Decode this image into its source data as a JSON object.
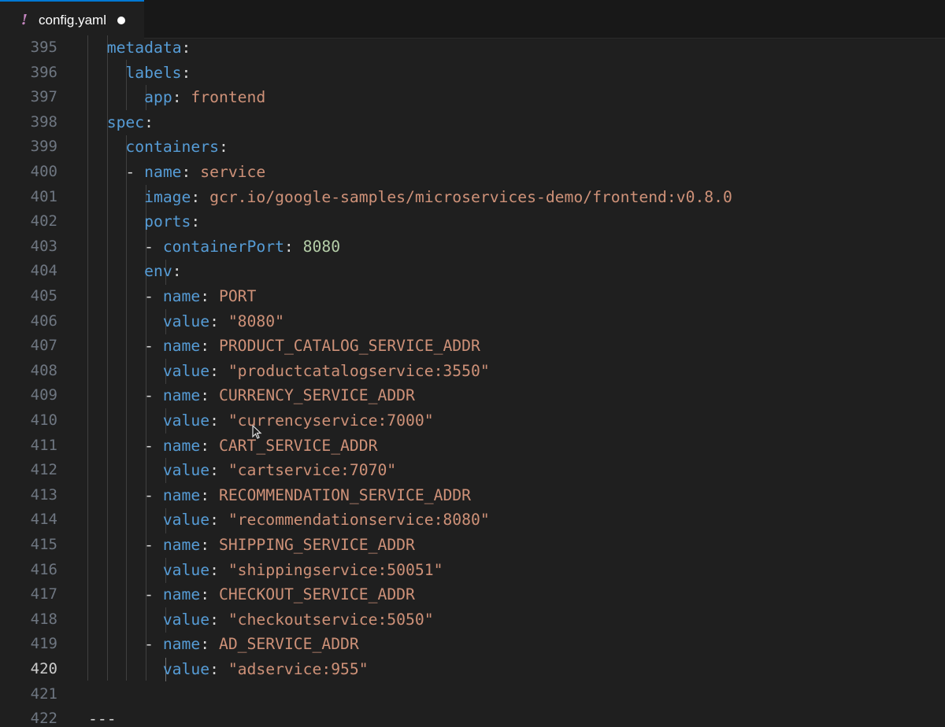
{
  "tab": {
    "icon": "!",
    "title": "config.yaml",
    "modified": true
  },
  "editor": {
    "active_line": "420",
    "lines": [
      {
        "num": "395",
        "indent": "  ",
        "key": "metadata",
        "sep": ":",
        "val": "",
        "vtype": ""
      },
      {
        "num": "396",
        "indent": "    ",
        "key": "labels",
        "sep": ":",
        "val": "",
        "vtype": ""
      },
      {
        "num": "397",
        "indent": "      ",
        "key": "app",
        "sep": ": ",
        "val": "frontend",
        "vtype": "s"
      },
      {
        "num": "398",
        "indent": "  ",
        "key": "spec",
        "sep": ":",
        "val": "",
        "vtype": ""
      },
      {
        "num": "399",
        "indent": "    ",
        "key": "containers",
        "sep": ":",
        "val": "",
        "vtype": ""
      },
      {
        "num": "400",
        "indent": "    - ",
        "key": "name",
        "sep": ": ",
        "val": "service",
        "vtype": "s"
      },
      {
        "num": "401",
        "indent": "      ",
        "key": "image",
        "sep": ": ",
        "val": "gcr.io/google-samples/microservices-demo/frontend:v0.8.0",
        "vtype": "s"
      },
      {
        "num": "402",
        "indent": "      ",
        "key": "ports",
        "sep": ":",
        "val": "",
        "vtype": ""
      },
      {
        "num": "403",
        "indent": "      - ",
        "key": "containerPort",
        "sep": ": ",
        "val": "8080",
        "vtype": "n"
      },
      {
        "num": "404",
        "indent": "      ",
        "key": "env",
        "sep": ":",
        "val": "",
        "vtype": ""
      },
      {
        "num": "405",
        "indent": "      - ",
        "key": "name",
        "sep": ": ",
        "val": "PORT",
        "vtype": "s"
      },
      {
        "num": "406",
        "indent": "        ",
        "key": "value",
        "sep": ": ",
        "val": "\"8080\"",
        "vtype": "s"
      },
      {
        "num": "407",
        "indent": "      - ",
        "key": "name",
        "sep": ": ",
        "val": "PRODUCT_CATALOG_SERVICE_ADDR",
        "vtype": "s"
      },
      {
        "num": "408",
        "indent": "        ",
        "key": "value",
        "sep": ": ",
        "val": "\"productcatalogservice:3550\"",
        "vtype": "s"
      },
      {
        "num": "409",
        "indent": "      - ",
        "key": "name",
        "sep": ": ",
        "val": "CURRENCY_SERVICE_ADDR",
        "vtype": "s"
      },
      {
        "num": "410",
        "indent": "        ",
        "key": "value",
        "sep": ": ",
        "val": "\"currencyservice:7000\"",
        "vtype": "s"
      },
      {
        "num": "411",
        "indent": "      - ",
        "key": "name",
        "sep": ": ",
        "val": "CART_SERVICE_ADDR",
        "vtype": "s"
      },
      {
        "num": "412",
        "indent": "        ",
        "key": "value",
        "sep": ": ",
        "val": "\"cartservice:7070\"",
        "vtype": "s"
      },
      {
        "num": "413",
        "indent": "      - ",
        "key": "name",
        "sep": ": ",
        "val": "RECOMMENDATION_SERVICE_ADDR",
        "vtype": "s"
      },
      {
        "num": "414",
        "indent": "        ",
        "key": "value",
        "sep": ": ",
        "val": "\"recommendationservice:8080\"",
        "vtype": "s"
      },
      {
        "num": "415",
        "indent": "      - ",
        "key": "name",
        "sep": ": ",
        "val": "SHIPPING_SERVICE_ADDR",
        "vtype": "s"
      },
      {
        "num": "416",
        "indent": "        ",
        "key": "value",
        "sep": ": ",
        "val": "\"shippingservice:50051\"",
        "vtype": "s"
      },
      {
        "num": "417",
        "indent": "      - ",
        "key": "name",
        "sep": ": ",
        "val": "CHECKOUT_SERVICE_ADDR",
        "vtype": "s"
      },
      {
        "num": "418",
        "indent": "        ",
        "key": "value",
        "sep": ": ",
        "val": "\"checkoutservice:5050\"",
        "vtype": "s"
      },
      {
        "num": "419",
        "indent": "      - ",
        "key": "name",
        "sep": ": ",
        "val": "AD_SERVICE_ADDR",
        "vtype": "s"
      },
      {
        "num": "420",
        "indent": "        ",
        "key": "value",
        "sep": ": ",
        "val": "\"adservice:955\"",
        "vtype": "s"
      },
      {
        "num": "421",
        "indent": "",
        "key": "",
        "sep": "",
        "val": "",
        "vtype": ""
      },
      {
        "num": "422",
        "indent": "",
        "key": "",
        "sep": "",
        "val": "---",
        "vtype": "p"
      }
    ]
  }
}
